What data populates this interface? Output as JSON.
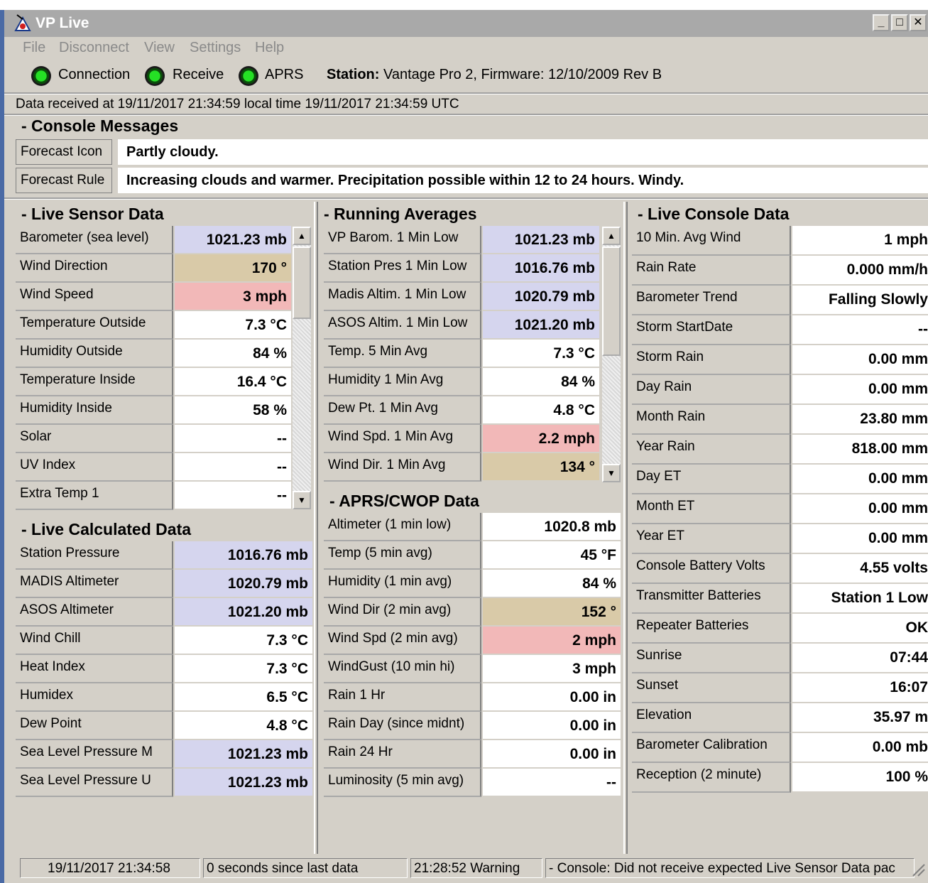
{
  "window": {
    "title": "VP Live",
    "minimize": "_",
    "maximize": "□",
    "close": "✕"
  },
  "menu": [
    "File",
    "Disconnect",
    "View",
    "Settings",
    "Help"
  ],
  "toolbar": {
    "indicators": [
      "Connection",
      "Receive",
      "APRS"
    ],
    "station_label": "Station:",
    "station_value": "Vantage Pro 2,  Firmware: 12/10/2009 Rev B"
  },
  "data_received": "Data received at  19/11/2017 21:34:59 local time      19/11/2017 21:34:59 UTC",
  "console_messages": {
    "header": "- Console Messages",
    "rows": [
      {
        "label": "Forecast Icon",
        "value": "Partly cloudy."
      },
      {
        "label": "Forecast Rule",
        "value": "Increasing clouds and warmer. Precipitation possible within 12 to 24 hours. Windy."
      }
    ]
  },
  "live_sensor": {
    "header": "- Live Sensor Data",
    "rows": [
      {
        "label": "Barometer (sea level)",
        "value": "1021.23 mb",
        "color": "blue"
      },
      {
        "label": "Wind Direction",
        "value": "170 °",
        "color": "tan"
      },
      {
        "label": "Wind Speed",
        "value": "3 mph",
        "color": "pink"
      },
      {
        "label": "Temperature Outside",
        "value": "7.3 °C",
        "color": ""
      },
      {
        "label": "Humidity Outside",
        "value": "84 %",
        "color": ""
      },
      {
        "label": "Temperature Inside",
        "value": "16.4 °C",
        "color": ""
      },
      {
        "label": "Humidity Inside",
        "value": "58 %",
        "color": ""
      },
      {
        "label": "Solar",
        "value": "--",
        "color": ""
      },
      {
        "label": "UV Index",
        "value": "--",
        "color": ""
      },
      {
        "label": "Extra Temp 1",
        "value": "--",
        "color": ""
      }
    ]
  },
  "live_calculated": {
    "header": "- Live Calculated Data",
    "rows": [
      {
        "label": "Station Pressure",
        "value": "1016.76 mb",
        "color": "blue"
      },
      {
        "label": "MADIS Altimeter",
        "value": "1020.79 mb",
        "color": "blue"
      },
      {
        "label": "ASOS Altimeter",
        "value": "1021.20 mb",
        "color": "blue"
      },
      {
        "label": "Wind Chill",
        "value": "7.3 °C",
        "color": ""
      },
      {
        "label": "Heat Index",
        "value": "7.3 °C",
        "color": ""
      },
      {
        "label": "Humidex",
        "value": "6.5 °C",
        "color": ""
      },
      {
        "label": "Dew Point",
        "value": "4.8 °C",
        "color": ""
      },
      {
        "label": "Sea Level Pressure M",
        "value": "1021.23 mb",
        "color": "blue"
      },
      {
        "label": "Sea Level Pressure U",
        "value": "1021.23 mb",
        "color": "blue"
      }
    ]
  },
  "running_averages": {
    "header": "- Running Averages",
    "rows": [
      {
        "label": "VP Barom. 1 Min Low",
        "value": "1021.23 mb",
        "color": "blue"
      },
      {
        "label": "Station Pres 1 Min Low",
        "value": "1016.76 mb",
        "color": "blue"
      },
      {
        "label": "Madis Altim. 1 Min Low",
        "value": "1020.79 mb",
        "color": "blue"
      },
      {
        "label": "ASOS Altim. 1 Min Low",
        "value": "1021.20 mb",
        "color": "blue"
      },
      {
        "label": "Temp. 5 Min Avg",
        "value": "7.3 °C",
        "color": ""
      },
      {
        "label": "Humidity 1 Min Avg",
        "value": "84 %",
        "color": ""
      },
      {
        "label": "Dew Pt. 1 Min Avg",
        "value": "4.8 °C",
        "color": ""
      },
      {
        "label": "Wind Spd. 1 Min Avg",
        "value": "2.2 mph",
        "color": "pink"
      },
      {
        "label": "Wind Dir. 1 Min Avg",
        "value": "134 °",
        "color": "tan"
      }
    ]
  },
  "aprs": {
    "header": "- APRS/CWOP Data",
    "rows": [
      {
        "label": "Altimeter (1 min low)",
        "value": "1020.8 mb",
        "color": ""
      },
      {
        "label": "Temp (5 min avg)",
        "value": "45 °F",
        "color": ""
      },
      {
        "label": "Humidity (1 min avg)",
        "value": "84 %",
        "color": ""
      },
      {
        "label": "Wind Dir (2 min avg)",
        "value": "152 °",
        "color": "tan"
      },
      {
        "label": "Wind Spd (2 min avg)",
        "value": "2 mph",
        "color": "pink"
      },
      {
        "label": "WindGust (10 min hi)",
        "value": "3 mph",
        "color": ""
      },
      {
        "label": "Rain 1 Hr",
        "value": "0.00 in",
        "color": ""
      },
      {
        "label": "Rain Day (since midnt)",
        "value": "0.00 in",
        "color": ""
      },
      {
        "label": "Rain 24 Hr",
        "value": "0.00 in",
        "color": ""
      },
      {
        "label": "Luminosity (5 min avg)",
        "value": "--",
        "color": ""
      }
    ]
  },
  "live_console": {
    "header": "- Live Console Data",
    "rows": [
      {
        "label": "10 Min. Avg Wind",
        "value": "1 mph",
        "color": ""
      },
      {
        "label": "Rain Rate",
        "value": "0.000 mm/h",
        "color": ""
      },
      {
        "label": "Barometer Trend",
        "value": "Falling Slowly",
        "color": ""
      },
      {
        "label": "Storm StartDate",
        "value": "--",
        "color": ""
      },
      {
        "label": "Storm Rain",
        "value": "0.00 mm",
        "color": ""
      },
      {
        "label": "Day Rain",
        "value": "0.00 mm",
        "color": ""
      },
      {
        "label": "Month Rain",
        "value": "23.80 mm",
        "color": ""
      },
      {
        "label": "Year Rain",
        "value": "818.00 mm",
        "color": ""
      },
      {
        "label": "Day ET",
        "value": "0.00 mm",
        "color": ""
      },
      {
        "label": "Month ET",
        "value": "0.00 mm",
        "color": ""
      },
      {
        "label": "Year ET",
        "value": "0.00 mm",
        "color": ""
      },
      {
        "label": "Console Battery Volts",
        "value": "4.55 volts",
        "color": ""
      },
      {
        "label": "Transmitter Batteries",
        "value": "Station 1 Low",
        "color": ""
      },
      {
        "label": "Repeater Batteries",
        "value": "OK",
        "color": ""
      },
      {
        "label": "Sunrise",
        "value": "07:44",
        "color": ""
      },
      {
        "label": "Sunset",
        "value": "16:07",
        "color": ""
      },
      {
        "label": "Elevation",
        "value": "35.97 m",
        "color": ""
      },
      {
        "label": "Barometer Calibration",
        "value": "0.00 mb",
        "color": ""
      },
      {
        "label": "Reception (2 minute)",
        "value": "100 %",
        "color": ""
      }
    ]
  },
  "status": {
    "time": "19/11/2017 21:34:58",
    "since": "0 seconds since last data",
    "warning": "21:28:52 Warning",
    "message": "- Console: Did not receive expected Live Sensor Data pac"
  }
}
